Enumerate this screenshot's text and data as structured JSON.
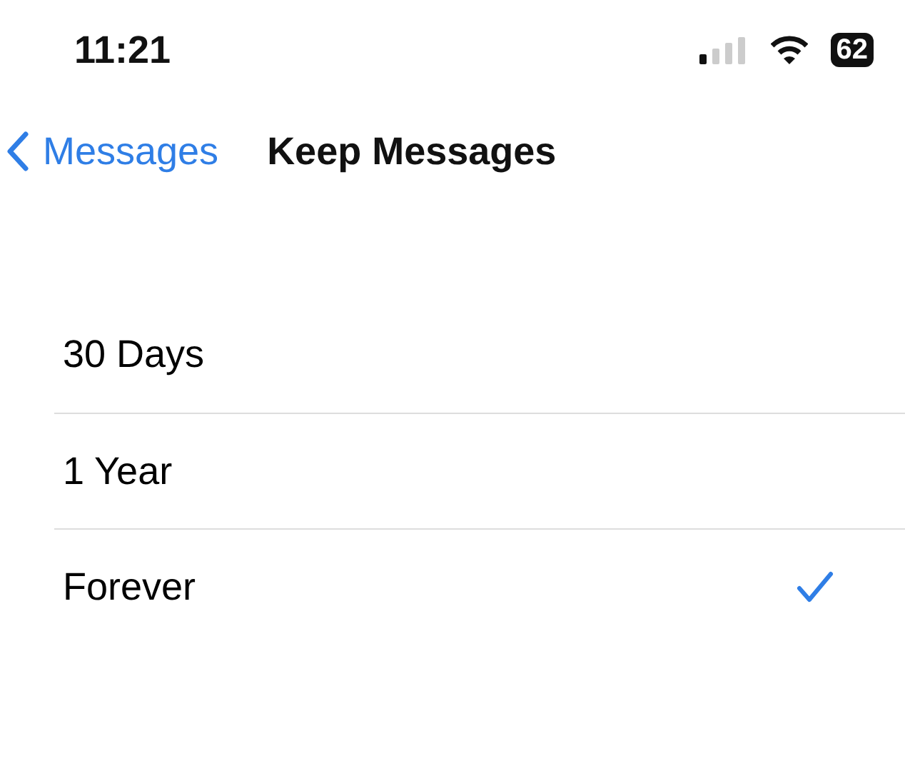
{
  "status_bar": {
    "time": "11:21",
    "battery": "62"
  },
  "nav": {
    "back": "Messages",
    "title": "Keep Messages"
  },
  "options": [
    {
      "label": "30 Days",
      "selected": false
    },
    {
      "label": "1 Year",
      "selected": false
    },
    {
      "label": "Forever",
      "selected": true
    }
  ]
}
